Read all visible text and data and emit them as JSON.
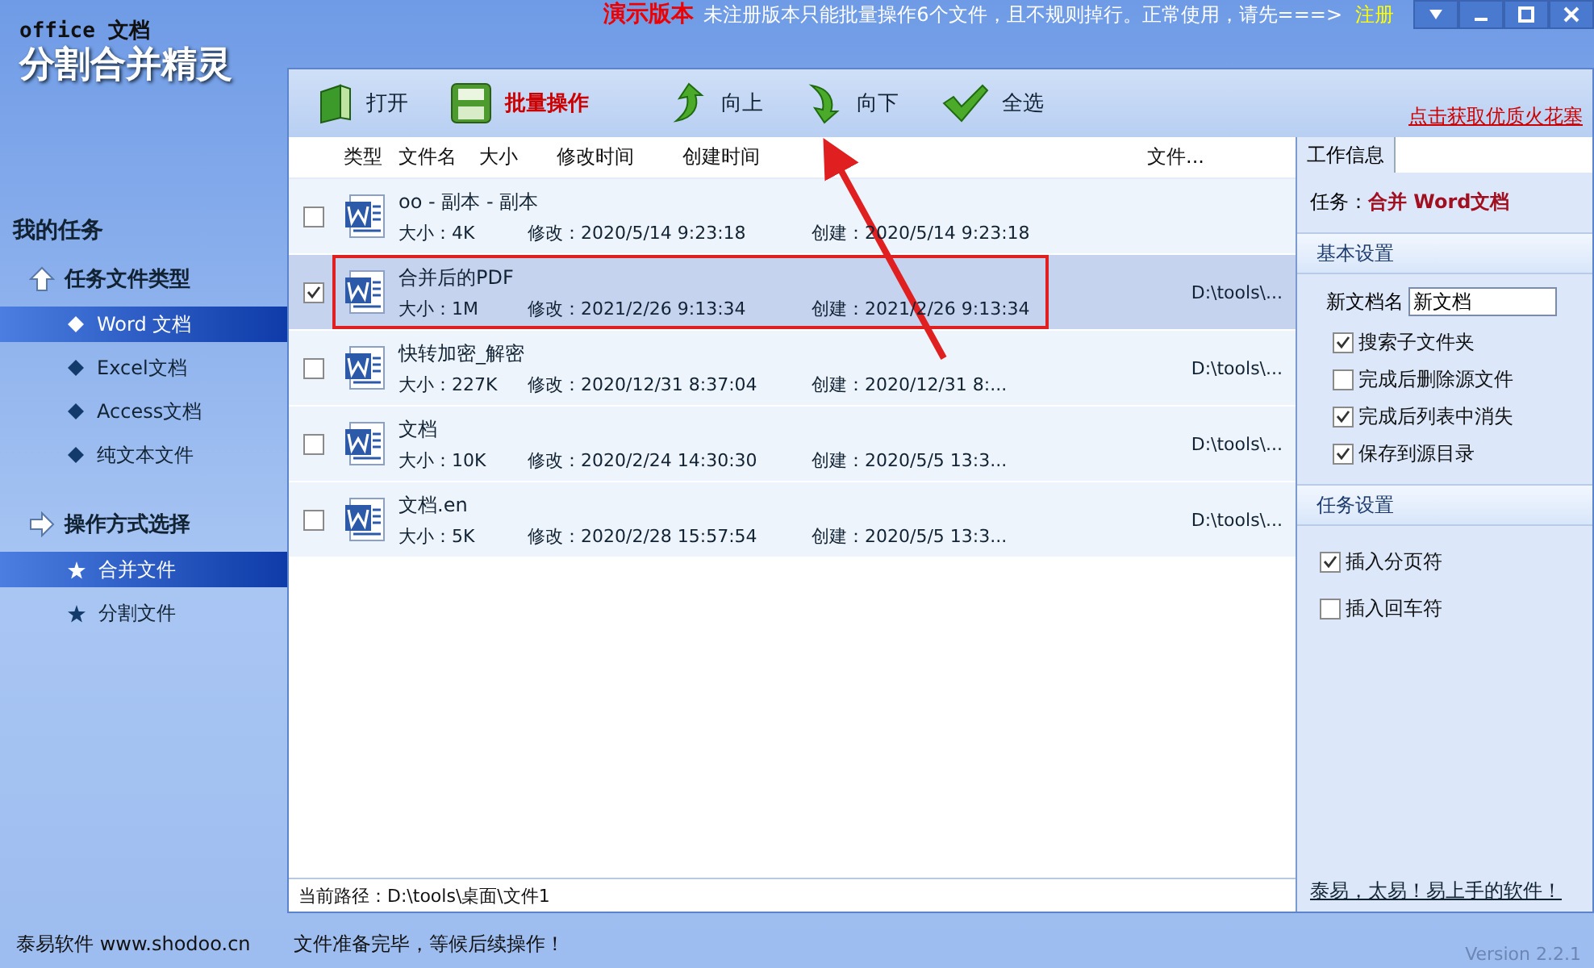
{
  "window": {
    "logo_small": "office 文档",
    "logo_title": "分割合并精灵",
    "demo_label": "演示版本",
    "notice": "未注册版本只能批量操作6个文件，且不规则掉行。正常使用，请先===>",
    "register_link": "注册"
  },
  "toolbar": {
    "buttons": [
      {
        "kind": "open",
        "label": "打开",
        "emphasis": false
      },
      {
        "kind": "batch",
        "label": "批量操作",
        "emphasis": true
      },
      {
        "kind": "up",
        "label": "向上",
        "emphasis": false
      },
      {
        "kind": "down",
        "label": "向下",
        "emphasis": false
      },
      {
        "kind": "selectall",
        "label": "全选",
        "emphasis": false
      }
    ],
    "promo_link": "点击获取优质火花塞"
  },
  "sidebar": {
    "title": "我的任务",
    "groups": [
      {
        "kind": "up",
        "title": "任务文件类型",
        "items": [
          {
            "label": "Word 文档",
            "selected": true
          },
          {
            "label": "Excel文档",
            "selected": false
          },
          {
            "label": "Access文档",
            "selected": false
          },
          {
            "label": "纯文本文件",
            "selected": false
          }
        ]
      },
      {
        "kind": "right",
        "title": "操作方式选择",
        "items": [
          {
            "label": "合并文件",
            "selected": true
          },
          {
            "label": "分割文件",
            "selected": false
          }
        ]
      }
    ]
  },
  "file_list": {
    "columns": [
      "类型",
      "文件名",
      "大小",
      "修改时间",
      "创建时间",
      "文件..."
    ],
    "rows": [
      {
        "name": "oo - 副本 - 副本",
        "size": "大小：4K",
        "modified": "修改：2020/5/14 9:23:18",
        "created": "创建：2020/5/14 9:23:18",
        "checked": false,
        "selected": false,
        "boxed": false
      },
      {
        "name": "合并后的PDF",
        "size": "大小：1M",
        "modified": "修改：2021/2/26 9:13:34",
        "created": "创建：2021/2/26 9:13:34",
        "path": "D:\\tools\\...",
        "checked": true,
        "selected": true,
        "boxed": true
      },
      {
        "name": "快转加密_解密",
        "size": "大小：227K",
        "modified": "修改：2020/12/31 8:37:04",
        "created": "创建：2020/12/31 8:...",
        "path": "D:\\tools\\...",
        "checked": false,
        "selected": false,
        "boxed": false
      },
      {
        "name": "文档",
        "size": "大小：10K",
        "modified": "修改：2020/2/24 14:30:30",
        "created": "创建：2020/5/5 13:3...",
        "path": "D:\\tools\\...",
        "checked": false,
        "selected": false,
        "boxed": false
      },
      {
        "name": "文档.en",
        "size": "大小：5K",
        "modified": "修改：2020/2/28 15:57:54",
        "created": "创建：2020/5/5 13:3...",
        "path": "D:\\tools\\...",
        "checked": false,
        "selected": false,
        "boxed": false
      }
    ],
    "current_path": "当前路径：D:\\tools\\桌面\\文件1"
  },
  "info_panel": {
    "tab": "工作信息",
    "task_label": "任务：",
    "task_value": "合并 Word文档",
    "sections": [
      {
        "title": "基本设置",
        "field_label": "新文档名",
        "field_value": "新文档",
        "options": [
          {
            "label": "搜索子文件夹",
            "checked": true
          },
          {
            "label": "完成后删除源文件",
            "checked": false
          },
          {
            "label": "完成后列表中消失",
            "checked": true
          },
          {
            "label": "保存到源目录",
            "checked": true
          }
        ]
      },
      {
        "title": "任务设置",
        "options": [
          {
            "label": "插入分页符",
            "checked": true
          },
          {
            "label": "插入回车符",
            "checked": false
          }
        ]
      }
    ],
    "slogan": "泰易，太易！易上手的软件！"
  },
  "status_bar": {
    "company": "泰易软件 www.shodoo.cn",
    "message": "文件准备完毕，等候后续操作！",
    "version": "Version 2.2.1"
  }
}
